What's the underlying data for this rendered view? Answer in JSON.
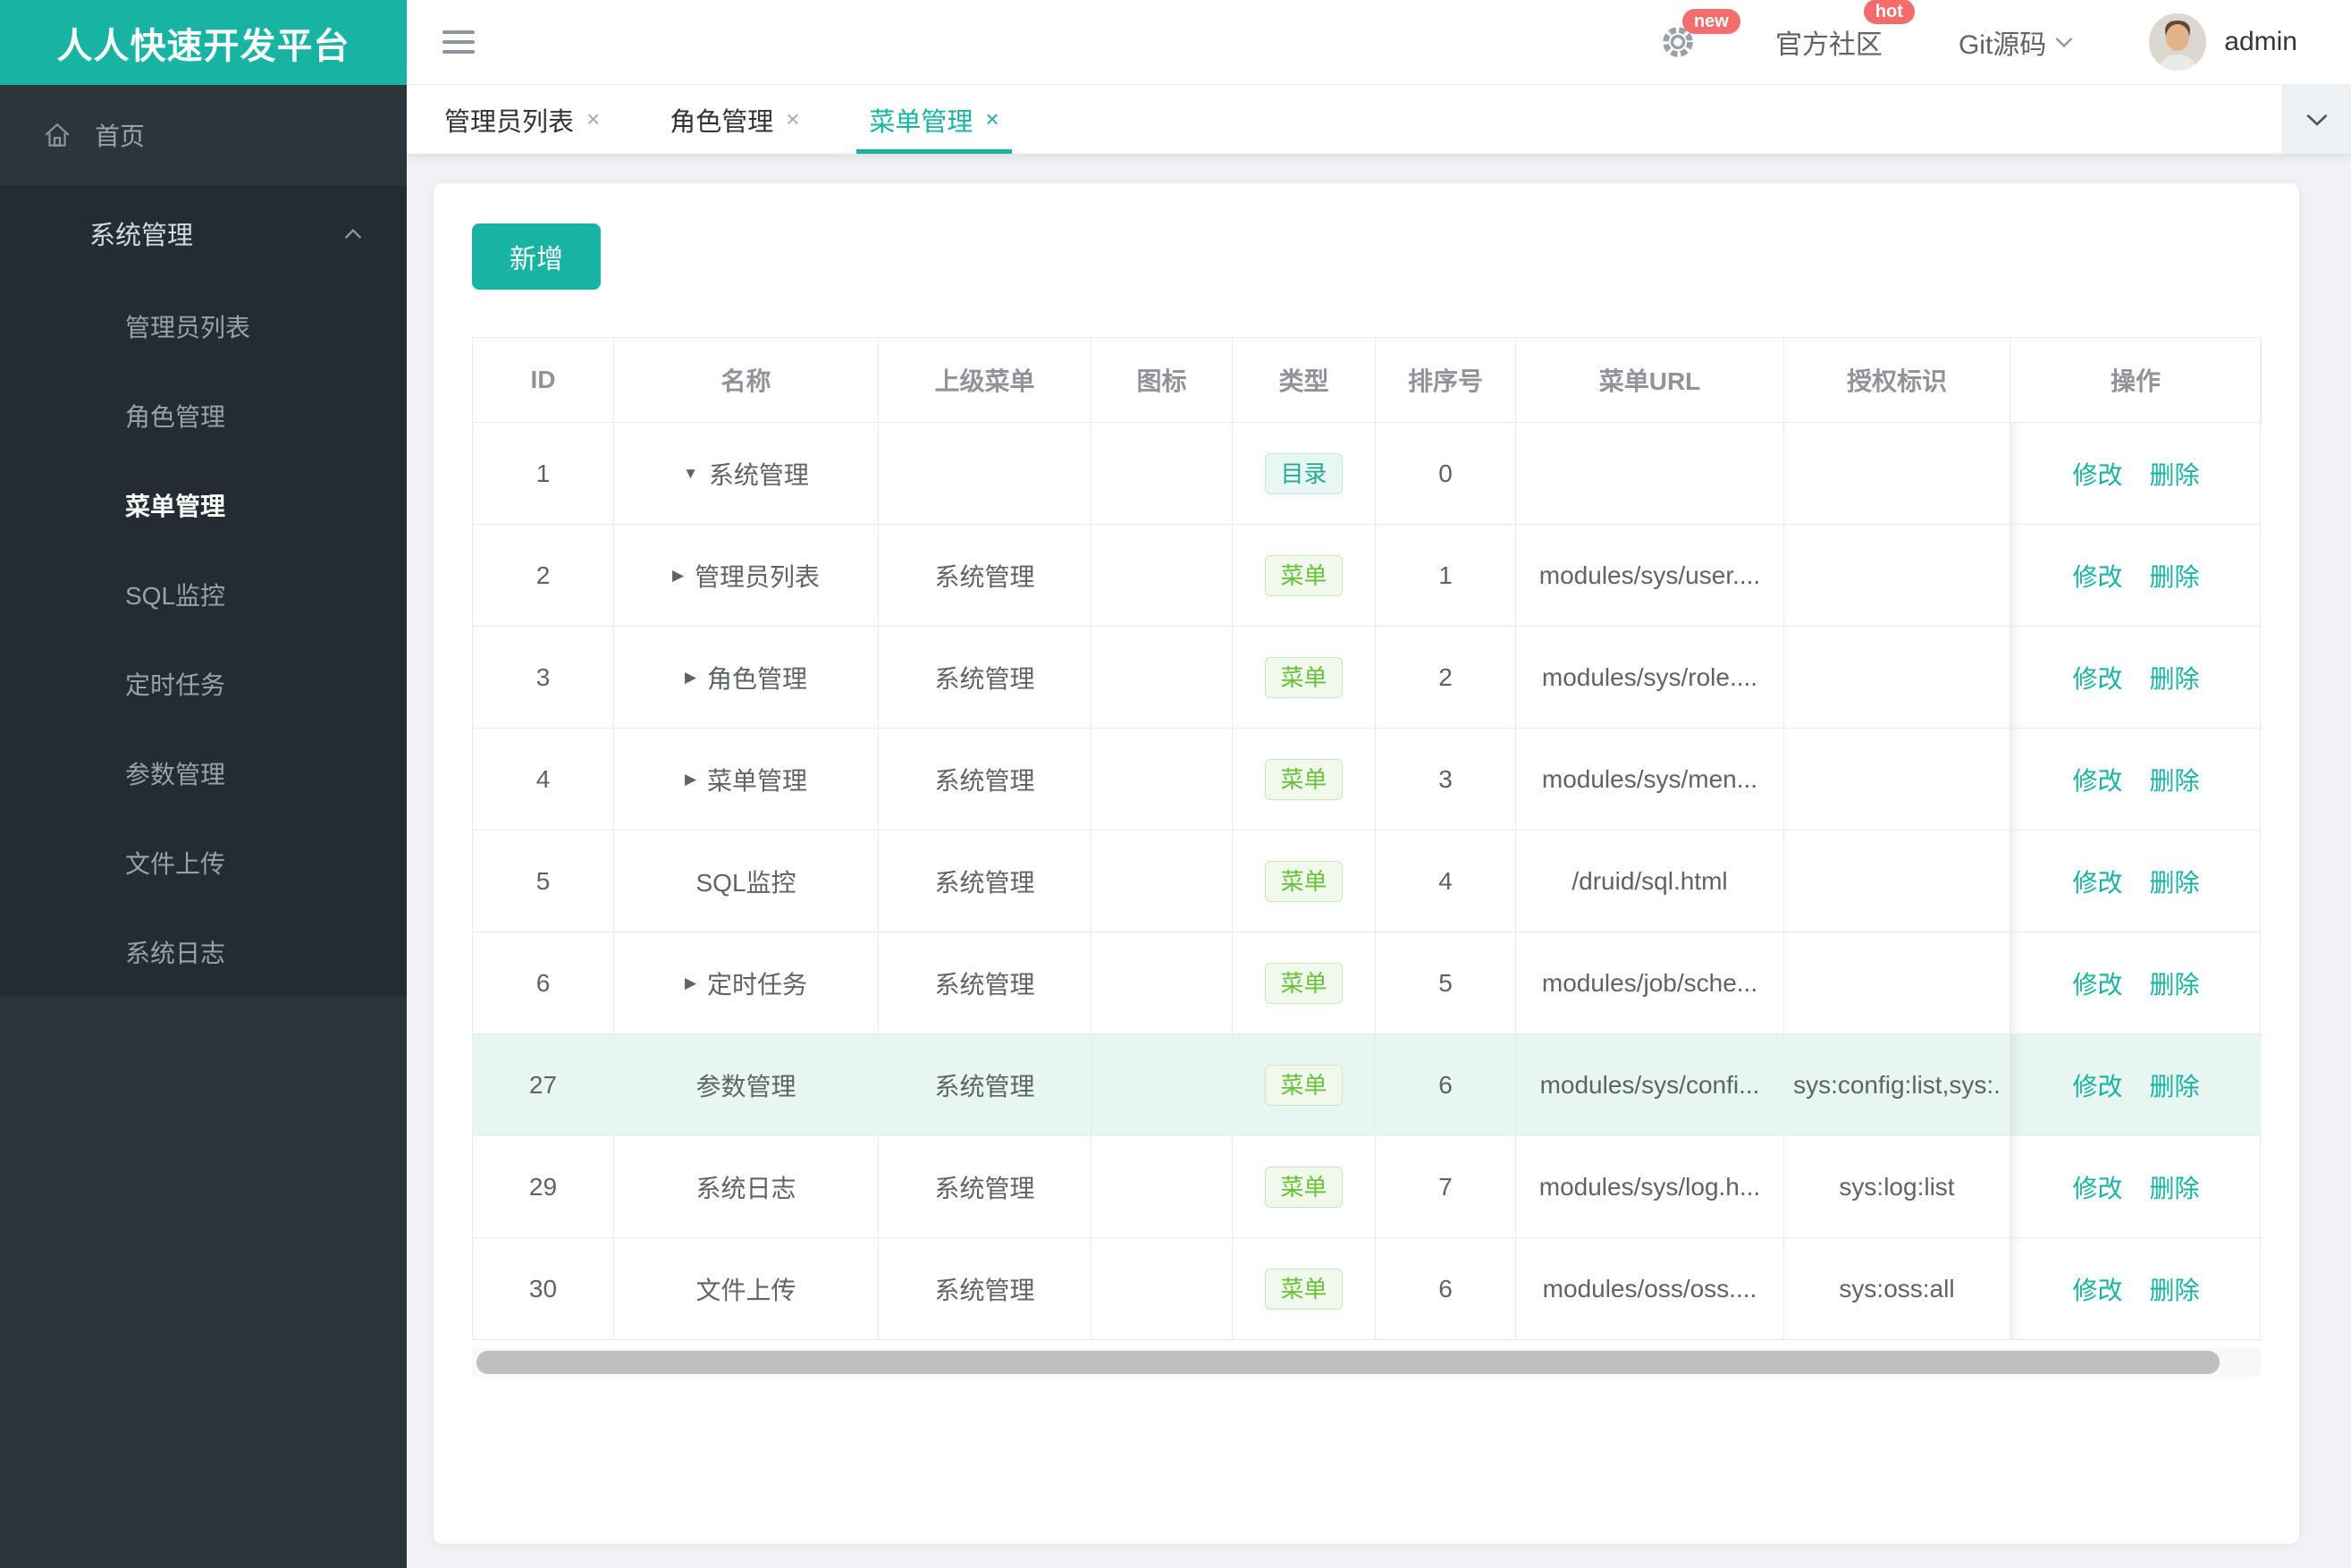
{
  "brand": {
    "title": "人人快速开发平台",
    "accent_color": "#17B3A3"
  },
  "icons": {
    "close": "×"
  },
  "sidebar": {
    "home": {
      "label": "首页"
    },
    "menu": {
      "label": "系统管理",
      "items": [
        {
          "label": "管理员列表",
          "active": false
        },
        {
          "label": "角色管理",
          "active": false
        },
        {
          "label": "菜单管理",
          "active": true
        },
        {
          "label": "SQL监控",
          "active": false
        },
        {
          "label": "定时任务",
          "active": false
        },
        {
          "label": "参数管理",
          "active": false
        },
        {
          "label": "文件上传",
          "active": false
        },
        {
          "label": "系统日志",
          "active": false
        }
      ]
    }
  },
  "topbar": {
    "new_badge": "new",
    "community": "官方社区",
    "hot_badge": "hot",
    "git": "Git源码",
    "user": "admin",
    "badge_color": "#F56C6C"
  },
  "tabs": [
    {
      "label": "管理员列表",
      "active": false
    },
    {
      "label": "角色管理",
      "active": false
    },
    {
      "label": "菜单管理",
      "active": true
    }
  ],
  "toolbar": {
    "add_label": "新增"
  },
  "table": {
    "columns": [
      "ID",
      "名称",
      "上级菜单",
      "图标",
      "类型",
      "排序号",
      "菜单URL",
      "授权标识",
      "操作"
    ],
    "actions": {
      "edit": "修改",
      "delete": "删除"
    },
    "badge_colors": {
      "dir": "#23A896",
      "menu": "#67C23A"
    },
    "rows": [
      {
        "id": "1",
        "arrow": "▼",
        "name": "系统管理",
        "parent": "",
        "type": "目录",
        "type_kind": "dir",
        "order": "0",
        "url": "",
        "perms": "",
        "highlight": false
      },
      {
        "id": "2",
        "arrow": "▶",
        "name": "管理员列表",
        "parent": "系统管理",
        "type": "菜单",
        "type_kind": "menu",
        "order": "1",
        "url": "modules/sys/user....",
        "perms": "",
        "highlight": false
      },
      {
        "id": "3",
        "arrow": "▶",
        "name": "角色管理",
        "parent": "系统管理",
        "type": "菜单",
        "type_kind": "menu",
        "order": "2",
        "url": "modules/sys/role....",
        "perms": "",
        "highlight": false
      },
      {
        "id": "4",
        "arrow": "▶",
        "name": "菜单管理",
        "parent": "系统管理",
        "type": "菜单",
        "type_kind": "menu",
        "order": "3",
        "url": "modules/sys/men...",
        "perms": "",
        "highlight": false
      },
      {
        "id": "5",
        "arrow": "",
        "name": "SQL监控",
        "parent": "系统管理",
        "type": "菜单",
        "type_kind": "menu",
        "order": "4",
        "url": "/druid/sql.html",
        "perms": "",
        "highlight": false
      },
      {
        "id": "6",
        "arrow": "▶",
        "name": "定时任务",
        "parent": "系统管理",
        "type": "菜单",
        "type_kind": "menu",
        "order": "5",
        "url": "modules/job/sche...",
        "perms": "",
        "highlight": false
      },
      {
        "id": "27",
        "arrow": "",
        "name": "参数管理",
        "parent": "系统管理",
        "type": "菜单",
        "type_kind": "menu",
        "order": "6",
        "url": "modules/sys/confi...",
        "perms": "sys:config:list,sys:.",
        "highlight": true
      },
      {
        "id": "29",
        "arrow": "",
        "name": "系统日志",
        "parent": "系统管理",
        "type": "菜单",
        "type_kind": "menu",
        "order": "7",
        "url": "modules/sys/log.h...",
        "perms": "sys:log:list",
        "highlight": false
      },
      {
        "id": "30",
        "arrow": "",
        "name": "文件上传",
        "parent": "系统管理",
        "type": "菜单",
        "type_kind": "menu",
        "order": "6",
        "url": "modules/oss/oss....",
        "perms": "sys:oss:all",
        "highlight": false
      }
    ]
  }
}
